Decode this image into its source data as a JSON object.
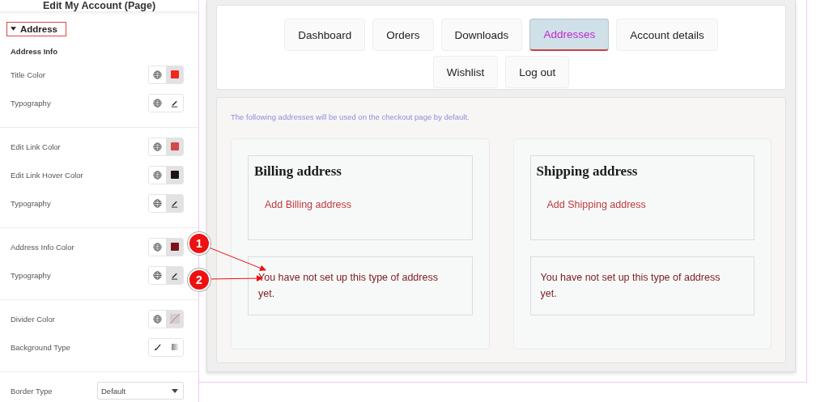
{
  "panel": {
    "title": "Edit My Account (Page)",
    "section": {
      "label": "Address",
      "expanded": true
    },
    "subheading": "Address Info",
    "groups": [
      [
        {
          "kind": "color",
          "label": "Title Color",
          "color": "#ee2a1f"
        },
        {
          "kind": "typography",
          "label": "Typography",
          "active": false
        }
      ],
      [
        {
          "kind": "color",
          "label": "Edit Link Color",
          "color": "#d24a4a"
        },
        {
          "kind": "color",
          "label": "Edit Link Hover Color",
          "color": "#1e1216"
        },
        {
          "kind": "typography",
          "label": "Typography",
          "active": true
        }
      ],
      [
        {
          "kind": "color",
          "label": "Address Info Color",
          "color": "#7c1418"
        },
        {
          "kind": "typography",
          "label": "Typography",
          "active": true
        }
      ],
      [
        {
          "kind": "empty-color",
          "label": "Divider Color"
        },
        {
          "kind": "background",
          "label": "Background Type"
        }
      ],
      [
        {
          "kind": "select",
          "label": "Border Type",
          "value": "Default"
        }
      ]
    ]
  },
  "tabs": [
    {
      "label": "Dashboard",
      "selected": false
    },
    {
      "label": "Orders",
      "selected": false
    },
    {
      "label": "Downloads",
      "selected": false
    },
    {
      "label": "Addresses",
      "selected": true
    },
    {
      "label": "Account details",
      "selected": false
    },
    {
      "label": "Wishlist",
      "selected": false
    },
    {
      "label": "Log out",
      "selected": false
    }
  ],
  "intro": "The following addresses will be used on the checkout page by default.",
  "addresses": [
    {
      "title": "Billing address",
      "link": "Add Billing address",
      "note": "You have not set up this type of address yet."
    },
    {
      "title": "Shipping address",
      "link": "Add Shipping address",
      "note": "You have not set up this type of address yet."
    }
  ],
  "annotations": [
    {
      "number": "1"
    },
    {
      "number": "2"
    }
  ]
}
